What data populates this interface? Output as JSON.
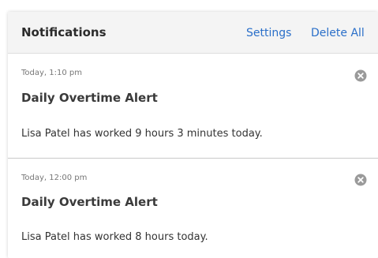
{
  "header": {
    "title": "Notifications",
    "settings_label": "Settings",
    "delete_all_label": "Delete All"
  },
  "notifications": [
    {
      "time": "Today, 1:10 pm",
      "title": "Daily Overtime Alert",
      "body": "Lisa Patel has worked 9 hours 3 minutes today.",
      "close_icon": "close-circle-icon"
    },
    {
      "time": "Today, 12:00 pm",
      "title": "Daily Overtime Alert",
      "body": "Lisa Patel has worked 8 hours today.",
      "close_icon": "close-circle-icon"
    }
  ],
  "colors": {
    "link": "#2a6fc9",
    "header_bg": "#f4f4f4",
    "close_icon": "#9a9a9a"
  }
}
